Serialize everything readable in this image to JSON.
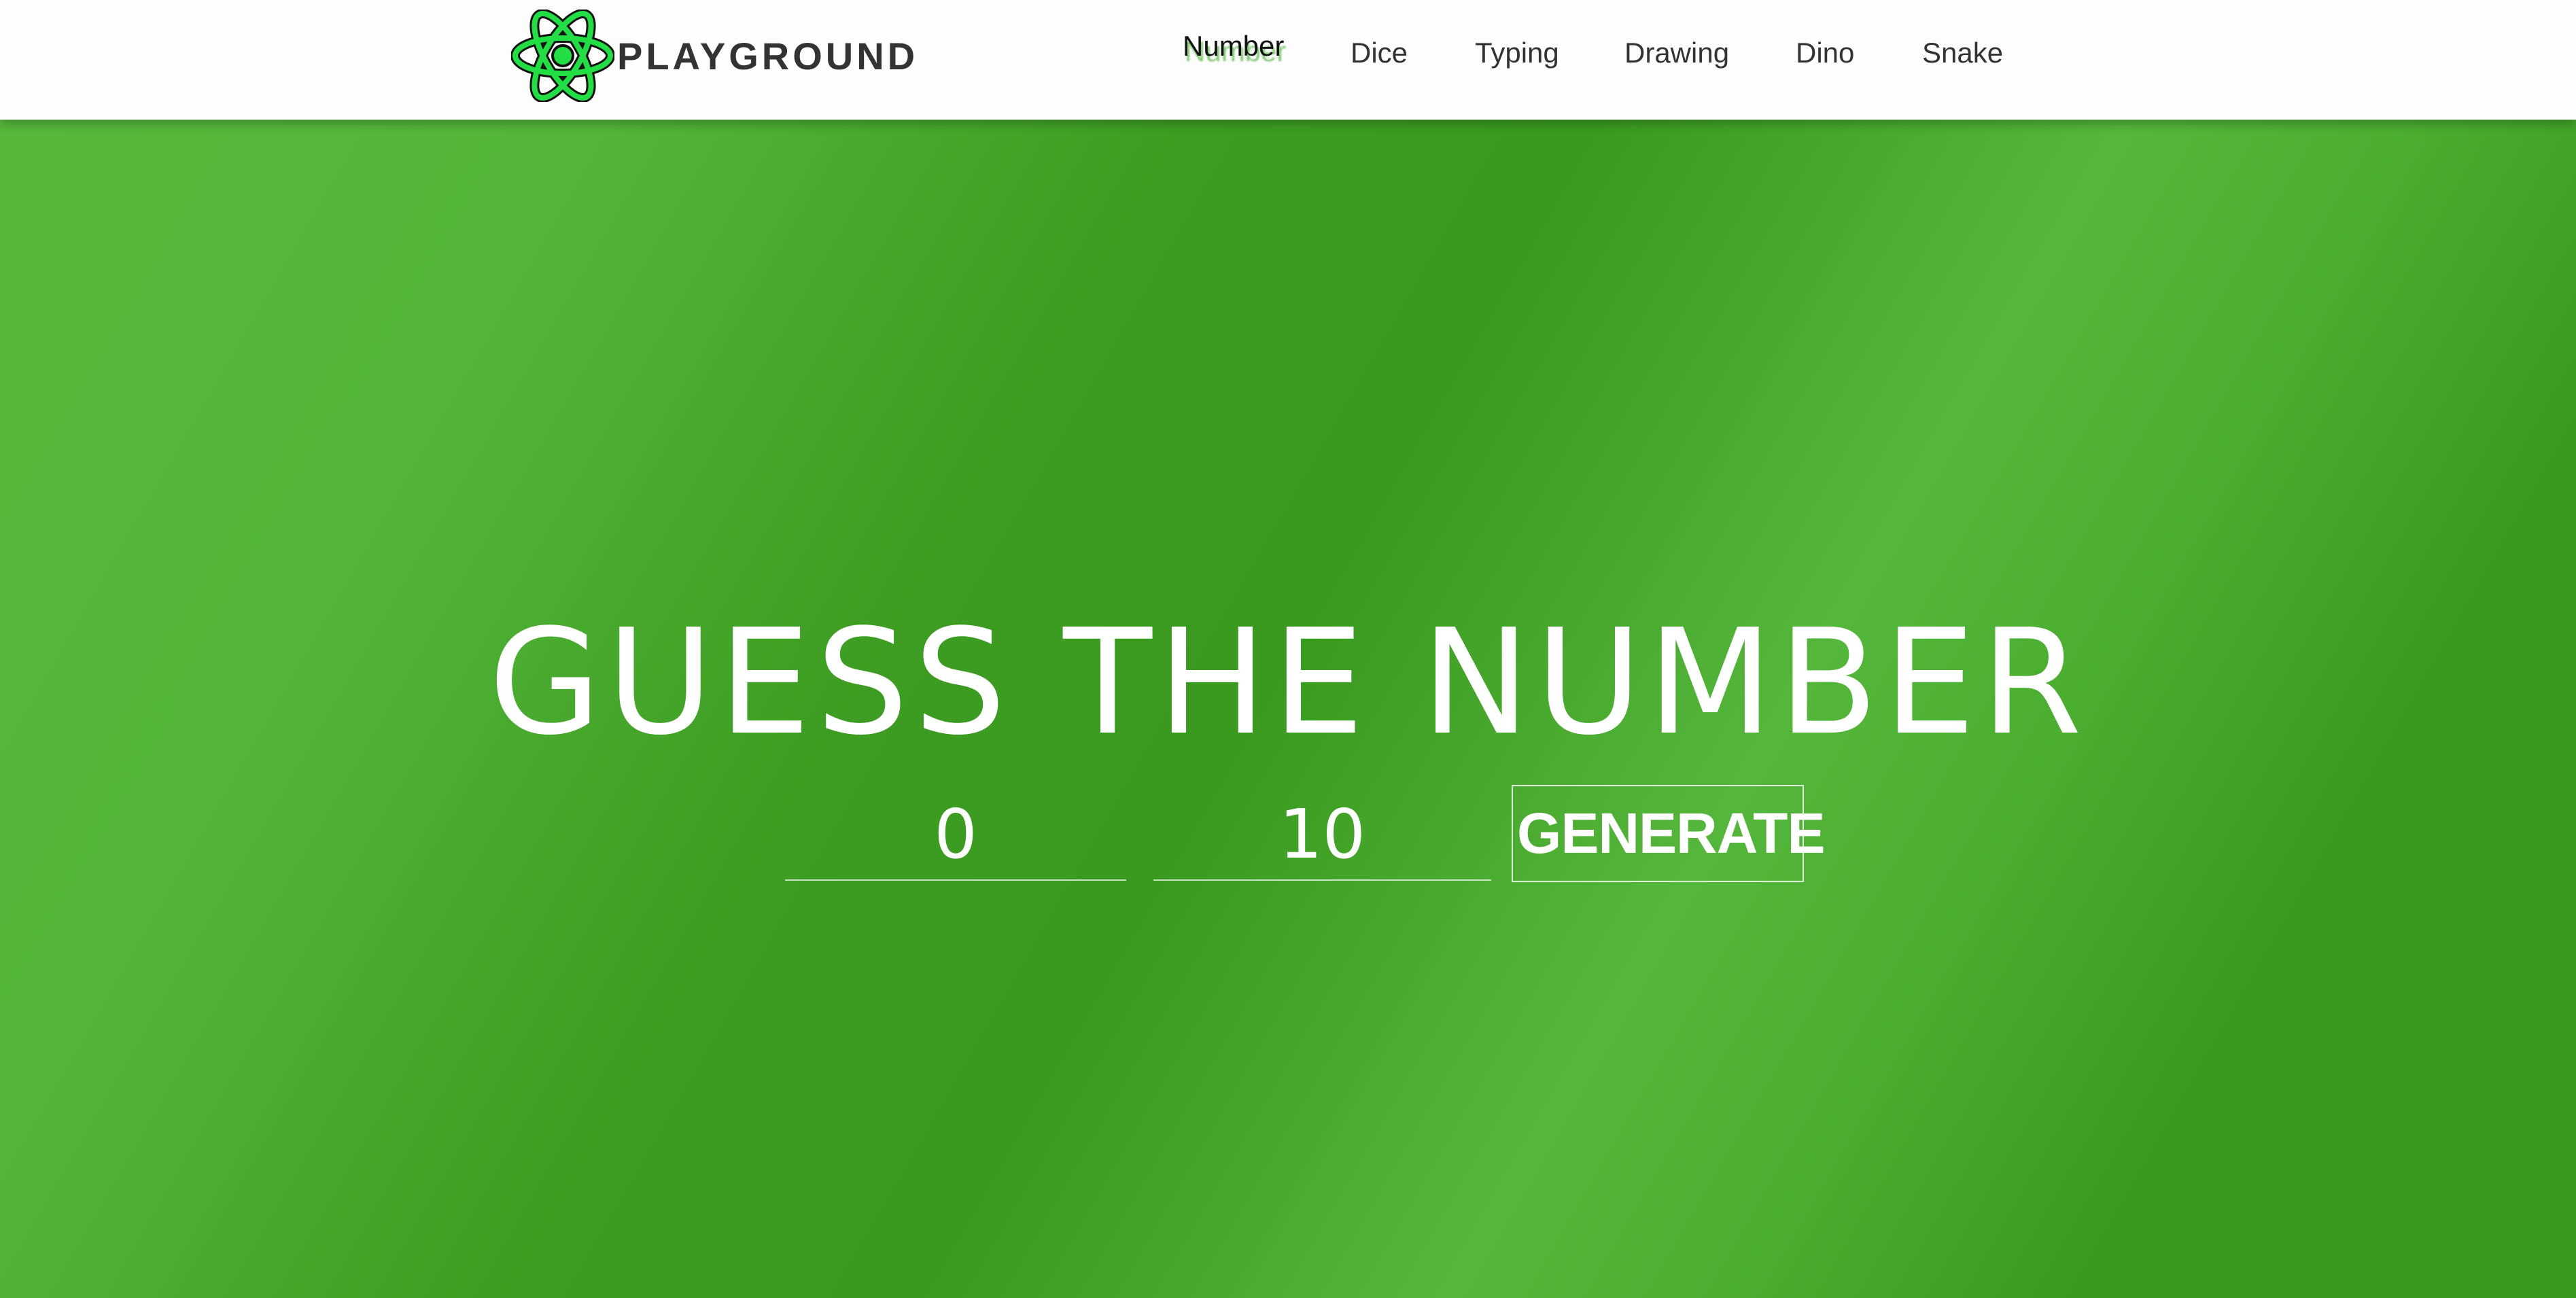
{
  "brand": {
    "name": "PLAYGROUND",
    "logo_icon": "atom-icon",
    "logo_color": "#22dd44"
  },
  "nav": [
    {
      "label": "Number",
      "active": true
    },
    {
      "label": "Dice"
    },
    {
      "label": "Typing"
    },
    {
      "label": "Drawing"
    },
    {
      "label": "Dino"
    },
    {
      "label": "Snake"
    }
  ],
  "main": {
    "title": "GUESS THE NUMBER",
    "min_value": "0",
    "max_value": "10",
    "generate_label": "GENERATE"
  }
}
